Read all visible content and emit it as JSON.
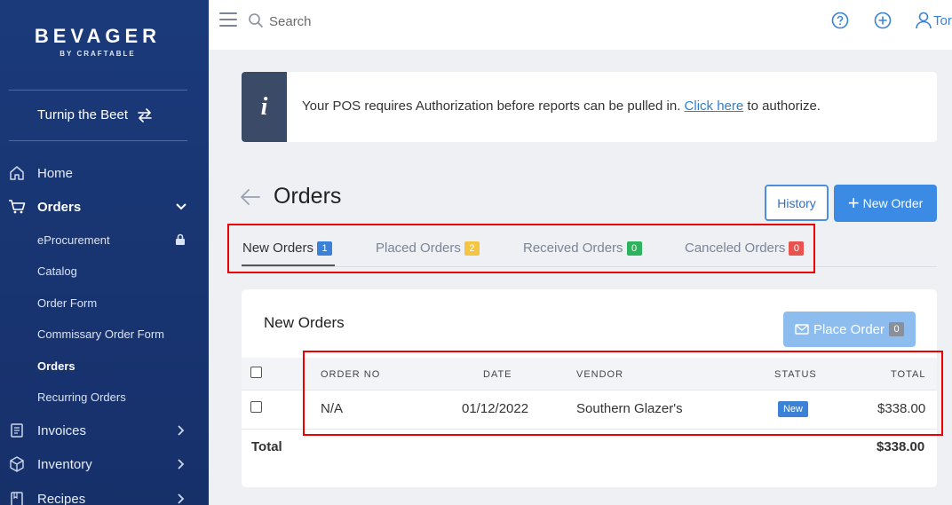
{
  "brand": {
    "name": "BEVAGER",
    "sub": "BY CRAFTABLE"
  },
  "location": {
    "name": "Turnip the Beet",
    "icon": "swap-arrows-icon"
  },
  "sidebar": {
    "home": "Home",
    "orders": "Orders",
    "orders_sub": [
      "eProcurement",
      "Catalog",
      "Order Form",
      "Commissary Order Form",
      "Orders",
      "Recurring Orders"
    ],
    "invoices": "Invoices",
    "inventory": "Inventory",
    "recipes": "Recipes"
  },
  "topbar": {
    "search_placeholder": "Search",
    "user": "Tor"
  },
  "alert": {
    "icon": "i",
    "text_before": "Your POS requires Authorization before reports can be pulled in.",
    "link": "Click here",
    "text_after": "to authorize."
  },
  "page": {
    "title": "Orders",
    "history_label": "History",
    "new_order_label": "New Order"
  },
  "tabs": [
    {
      "label": "New Orders",
      "count": "1",
      "color": "#3b82d6"
    },
    {
      "label": "Placed Orders",
      "count": "2",
      "color": "#f4c542"
    },
    {
      "label": "Received Orders",
      "count": "0",
      "color": "#2db35d"
    },
    {
      "label": "Canceled Orders",
      "count": "0",
      "color": "#e9534f"
    }
  ],
  "card": {
    "title": "New Orders",
    "place_order_label": "Place Order",
    "place_order_count": "0"
  },
  "table": {
    "headers": [
      "ORDER NO",
      "DATE",
      "VENDOR",
      "STATUS",
      "TOTAL"
    ],
    "rows": [
      {
        "order_no": "N/A",
        "date": "01/12/2022",
        "vendor": "Southern Glazer's",
        "status": "New",
        "total": "$338.00"
      }
    ],
    "total_label": "Total",
    "total_value": "$338.00"
  },
  "colors": {
    "sidebar": "#1b3a7a",
    "accent": "#3b8ae4",
    "highlight": "#ee0000"
  }
}
